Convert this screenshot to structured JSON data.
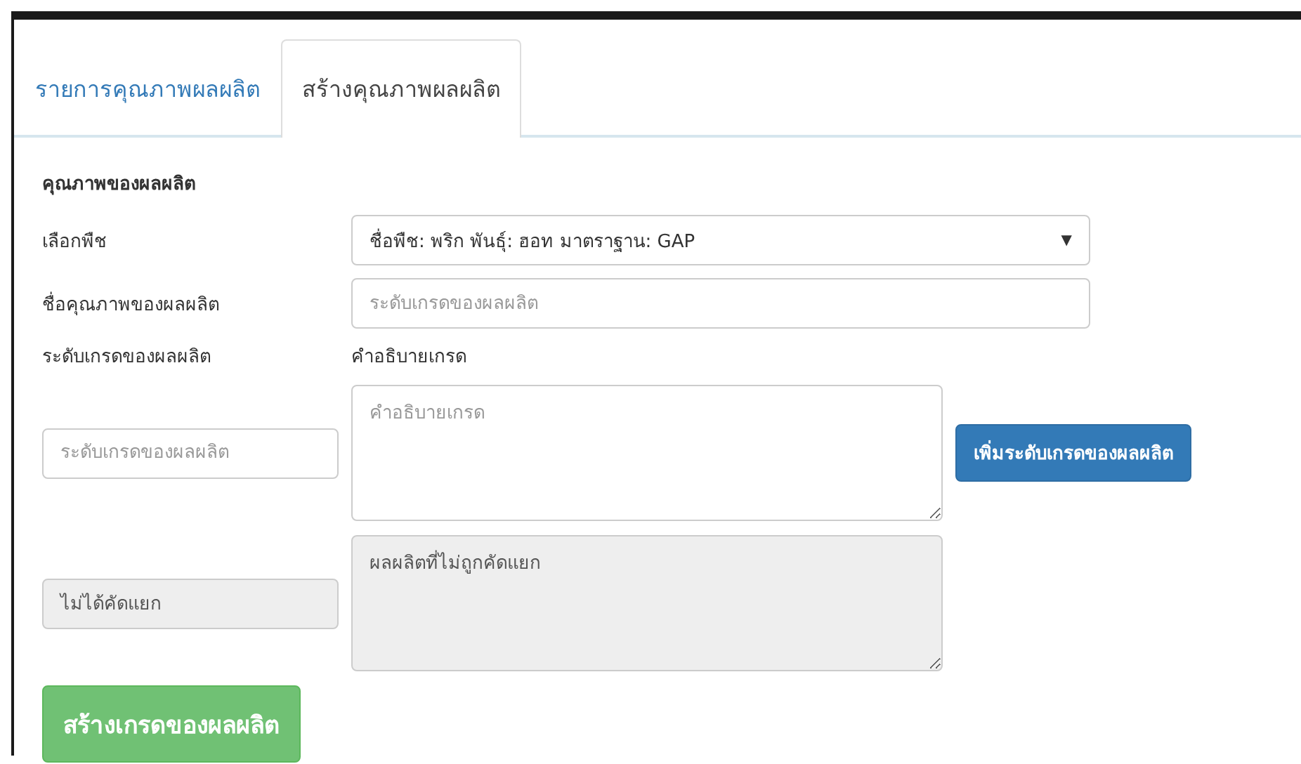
{
  "tabs": [
    {
      "label": "รายการคุณภาพผลผลิต",
      "selected": false
    },
    {
      "label": "สร้างคุณภาพผลผลิต",
      "selected": true
    }
  ],
  "form": {
    "heading": "คุณภาพของผลผลิต",
    "crop": {
      "label": "เลือกพืช",
      "value": "ชื่อพืช: พริก พันธุ์: ฮอท มาตราฐาน: GAP",
      "arrow": "▼"
    },
    "quality_name": {
      "label": "ชื่อคุณภาพของผลผลิต",
      "placeholder": "ระดับเกรดของผลผลิต"
    },
    "grade_label": "ระดับเกรดของผลผลิต",
    "description_label": "คำอธิบายเกรด",
    "grades": [
      {
        "grade": {
          "placeholder": "ระดับเกรดของผลผลิต"
        },
        "description": {
          "placeholder": "คำอธิบายเกรด"
        },
        "disabled": false,
        "add_button": "เพิ่มระดับเกรดของผลผลิต"
      },
      {
        "grade": {
          "value": "ไม่ได้คัดแยก"
        },
        "description": {
          "value": "ผลผลิตที่ไม่ถูกคัดแยก"
        },
        "disabled": true
      }
    ],
    "submit_button": "สร้างเกรดของผลผลิต"
  }
}
